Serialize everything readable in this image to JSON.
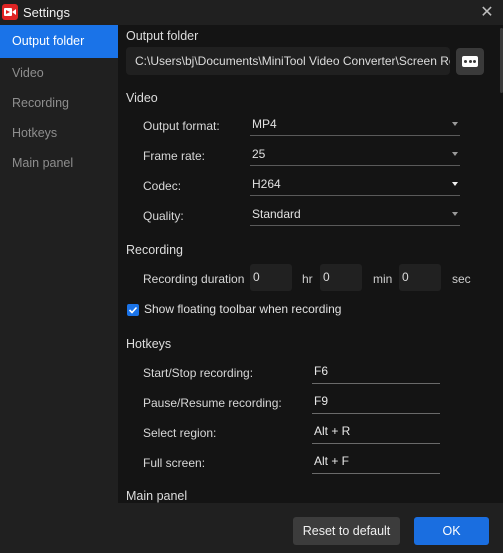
{
  "window": {
    "title": "Settings",
    "logo_icon": "video-recorder-icon",
    "close_glyph": "✕"
  },
  "sidebar": {
    "items": [
      {
        "label": "Output folder",
        "active": true
      },
      {
        "label": "Video",
        "active": false
      },
      {
        "label": "Recording",
        "active": false
      },
      {
        "label": "Hotkeys",
        "active": false
      },
      {
        "label": "Main panel",
        "active": false
      }
    ]
  },
  "output_folder": {
    "title": "Output folder",
    "path": "C:\\Users\\bj\\Documents\\MiniTool Video Converter\\Screen Record",
    "browse_icon": "more-dots-icon"
  },
  "video": {
    "title": "Video",
    "output_format": {
      "label": "Output format:",
      "value": "MP4"
    },
    "frame_rate": {
      "label": "Frame rate:",
      "value": "25"
    },
    "codec": {
      "label": "Codec:",
      "value": "H264"
    },
    "quality": {
      "label": "Quality:",
      "value": "Standard"
    }
  },
  "recording": {
    "title": "Recording",
    "duration_label": "Recording duration",
    "hours": "0",
    "hours_unit": "hr",
    "minutes": "0",
    "minutes_unit": "min",
    "seconds": "0",
    "seconds_unit": "sec",
    "floating_toolbar": {
      "label": "Show floating toolbar when recording",
      "checked": true
    }
  },
  "hotkeys": {
    "title": "Hotkeys",
    "items": [
      {
        "label": "Start/Stop recording:",
        "value": "F6"
      },
      {
        "label": "Pause/Resume recording:",
        "value": "F9"
      },
      {
        "label": "Select region:",
        "value": "Alt + R"
      },
      {
        "label": "Full screen:",
        "value": "Alt + F"
      }
    ]
  },
  "main_panel": {
    "title": "Main panel"
  },
  "footer": {
    "reset_label": "Reset to default",
    "ok_label": "OK"
  },
  "colors": {
    "accent": "#1a73e8",
    "logo": "#e02424",
    "background": "#202020",
    "content_background": "#141414"
  }
}
